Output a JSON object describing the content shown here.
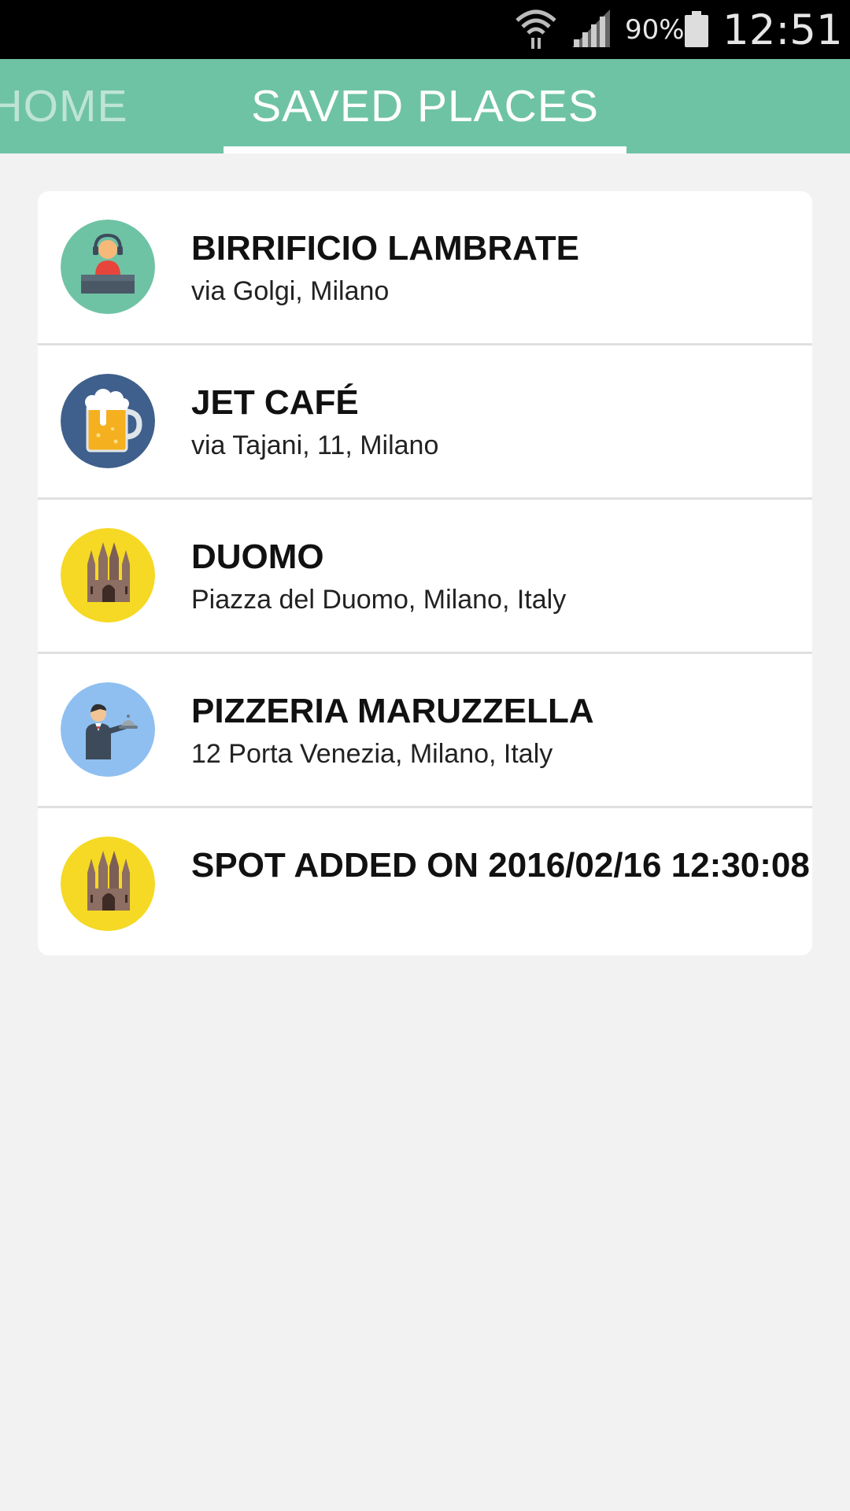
{
  "status_bar": {
    "battery_percent": "90%",
    "time": "12:51",
    "icons": [
      "wifi-icon",
      "signal-icon",
      "battery-icon"
    ]
  },
  "tabs": [
    {
      "label": "HOME",
      "selected": false
    },
    {
      "label": "SAVED PLACES",
      "selected": true
    }
  ],
  "colors": {
    "accent": "#6fc3a5",
    "background": "#f2f2f2"
  },
  "places": [
    {
      "title": "BIRRIFICIO LAMBRATE",
      "subtitle": "via Golgi, Milano",
      "icon": "dj-icon",
      "icon_bg": "#6fc3a5"
    },
    {
      "title": "JET CAFÉ",
      "subtitle": "via Tajani, 11, Milano",
      "icon": "beer-mug-icon",
      "icon_bg": "#3f5f8c"
    },
    {
      "title": "DUOMO",
      "subtitle": "Piazza del Duomo, Milano, Italy",
      "icon": "cathedral-icon",
      "icon_bg": "#f5d924"
    },
    {
      "title": "PIZZERIA MARUZZELLA",
      "subtitle": "12 Porta Venezia, Milano, Italy",
      "icon": "waiter-icon",
      "icon_bg": "#8fbff0"
    },
    {
      "title": "SPOT ADDED ON 2016/02/16 12:30:08",
      "subtitle": "",
      "icon": "cathedral-icon",
      "icon_bg": "#f5d924"
    }
  ]
}
